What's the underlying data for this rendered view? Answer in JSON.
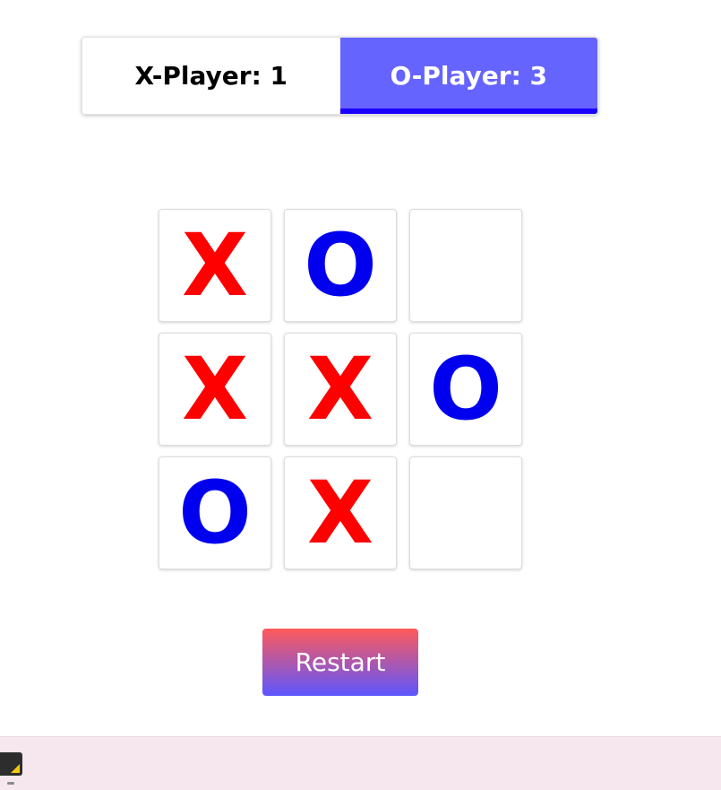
{
  "scoreboard": {
    "x_label": "X-Player: 1",
    "o_label": "O-Player: 3",
    "active_player": "O"
  },
  "board": {
    "cells": [
      "X",
      "O",
      "",
      "X",
      "X",
      "O",
      "O",
      "X",
      ""
    ]
  },
  "controls": {
    "restart_label": "Restart"
  },
  "colors": {
    "x_mark": "#ff0000",
    "o_mark": "#0000ee",
    "active_tab": "#6664ff",
    "active_underline": "#1a00ff",
    "restart_top": "#ff5a5a",
    "restart_bottom": "#5c56ff"
  },
  "taskbar": {
    "app_icon": "sticky-notes-icon"
  }
}
